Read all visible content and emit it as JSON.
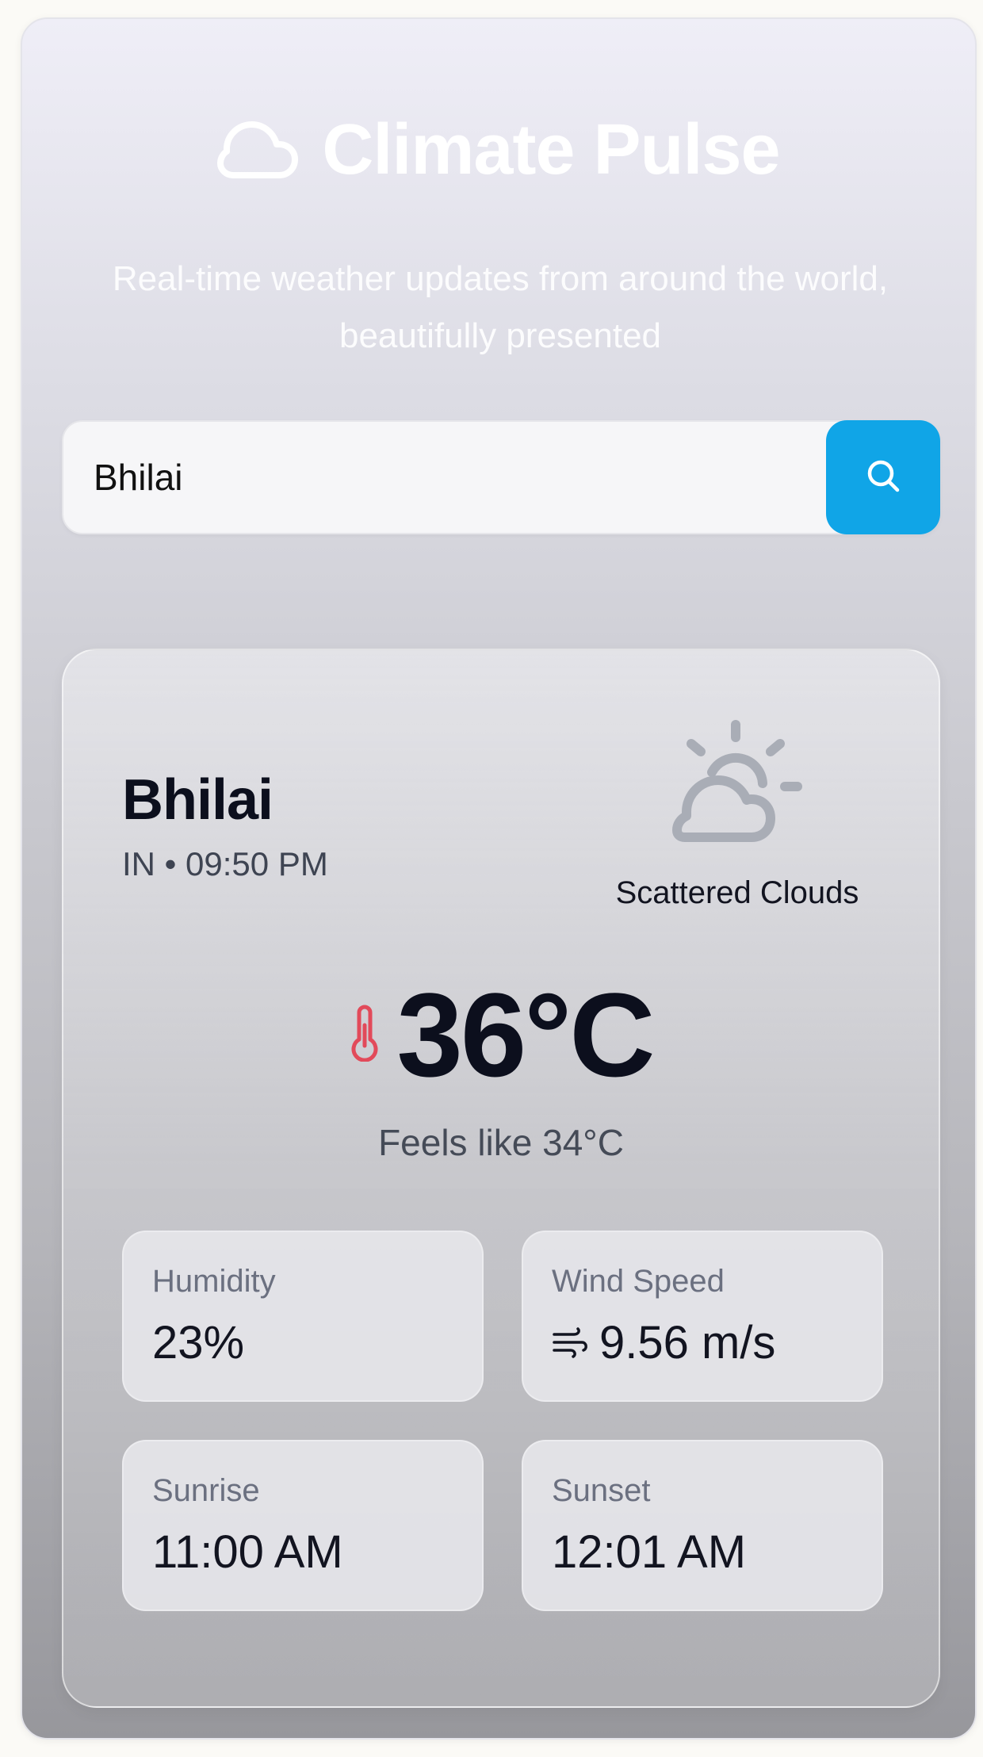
{
  "header": {
    "icon": "cloud-icon",
    "title": "Climate Pulse",
    "subtitle": "Real-time weather updates from around the world, beautifully presented"
  },
  "search": {
    "value": "Bhilai",
    "button_icon": "search-icon",
    "button_color": "#10a5e7"
  },
  "weather": {
    "city": "Bhilai",
    "meta": "IN • 09:50 PM",
    "condition": "Scattered Clouds",
    "condition_icon": "sun-behind-cloud-icon",
    "temperature": "36°C",
    "temperature_icon": "thermometer-icon",
    "temperature_icon_color": "#e24a5a",
    "feels_like": "Feels like 34°C"
  },
  "stats": {
    "humidity": {
      "label": "Humidity",
      "value": "23%"
    },
    "wind": {
      "label": "Wind Speed",
      "value": "9.56 m/s",
      "icon": "wind-icon"
    },
    "sunrise": {
      "label": "Sunrise",
      "value": "11:00 AM"
    },
    "sunset": {
      "label": "Sunset",
      "value": "12:01 AM"
    }
  }
}
